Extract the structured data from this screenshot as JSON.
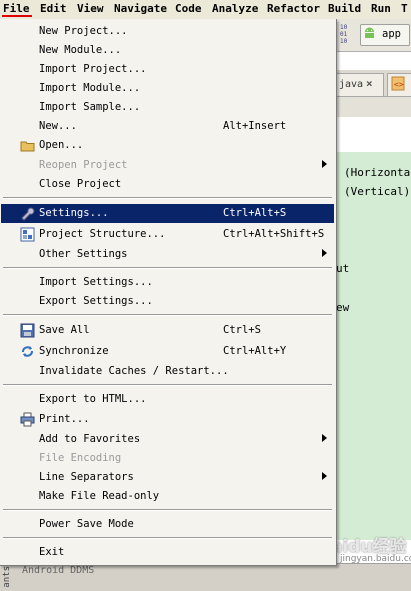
{
  "menubar": {
    "items": [
      "File",
      "Edit",
      "View",
      "Navigate",
      "Code",
      "Analyze",
      "Refactor",
      "Build",
      "Run",
      "T"
    ]
  },
  "toolbar": {
    "binary_text": "10\n01\n10",
    "run_config": "app"
  },
  "tabs": {
    "java_tab": "java",
    "close_glyph": "×"
  },
  "editor": {
    "lines": [
      "(Horizontal)",
      "(Vertical)",
      "ut",
      "ew"
    ]
  },
  "bottom": {
    "ddms_label": "Android DDMS",
    "side_label": "ants"
  },
  "watermark": {
    "main": "Baidu经验",
    "sub": "jingyan.baidu.com"
  },
  "file_menu": {
    "new_project": "New Project...",
    "new_module": "New Module...",
    "import_project": "Import Project...",
    "import_module": "Import Module...",
    "import_sample": "Import Sample...",
    "new": "New...",
    "new_shortcut": "Alt+Insert",
    "open": "Open...",
    "reopen_project": "Reopen Project",
    "close_project": "Close Project",
    "settings": "Settings...",
    "settings_shortcut": "Ctrl+Alt+S",
    "project_structure": "Project Structure...",
    "project_structure_shortcut": "Ctrl+Alt+Shift+S",
    "other_settings": "Other Settings",
    "import_settings": "Import Settings...",
    "export_settings": "Export Settings...",
    "save_all": "Save All",
    "save_all_shortcut": "Ctrl+S",
    "synchronize": "Synchronize",
    "synchronize_shortcut": "Ctrl+Alt+Y",
    "invalidate_caches": "Invalidate Caches / Restart...",
    "export_html": "Export to HTML...",
    "print": "Print...",
    "add_to_favorites": "Add to Favorites",
    "file_encoding": "File Encoding",
    "line_separators": "Line Separators",
    "make_read_only": "Make File Read-only",
    "power_save": "Power Save Mode",
    "exit": "Exit"
  },
  "colors": {
    "selection": "#0a246a",
    "menu_bg": "#f4f3ee",
    "editor_green": "#d4ecd4",
    "underline_red": "#e00000"
  }
}
